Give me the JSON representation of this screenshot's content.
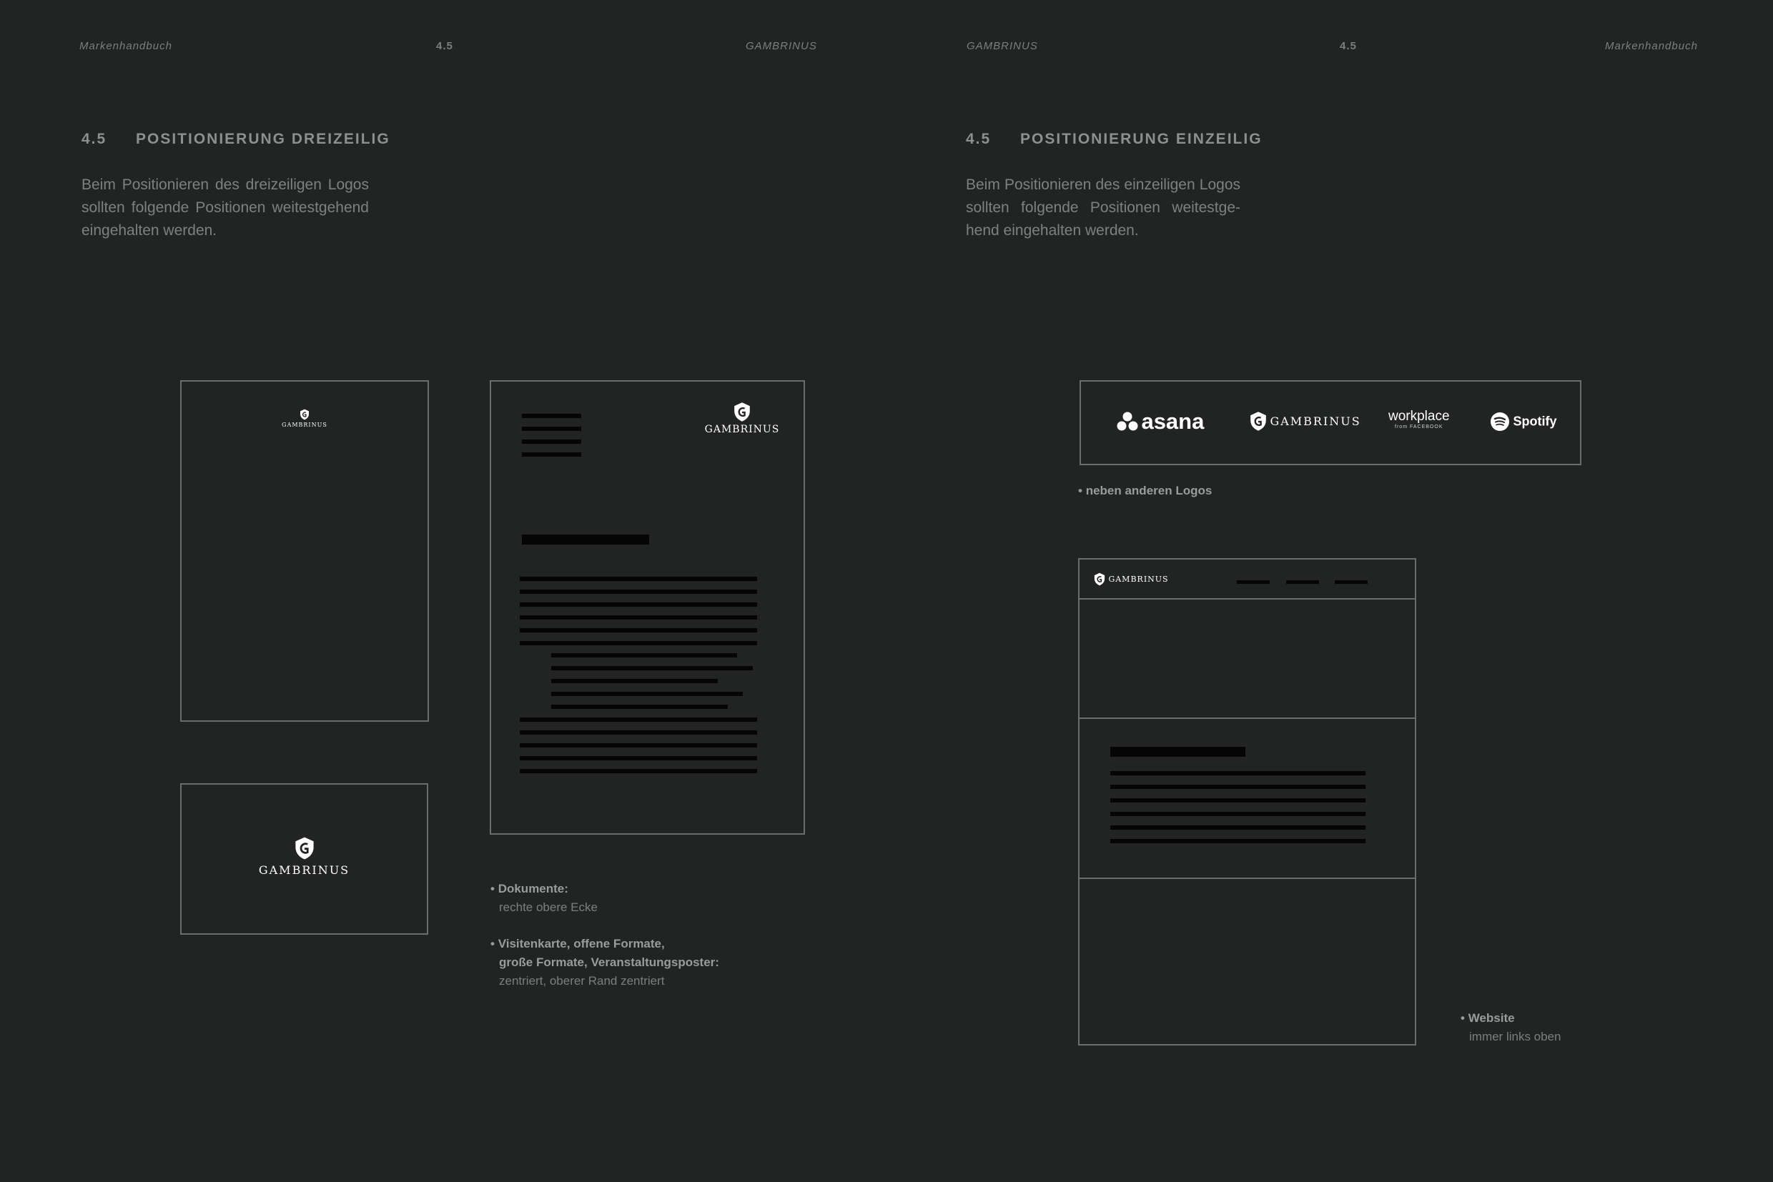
{
  "header": {
    "left_page": {
      "handbook": "Markenhandbuch",
      "section": "4.5",
      "brand": "GAMBRINUS"
    },
    "right_page": {
      "brand": "GAMBRINUS",
      "section": "4.5",
      "handbook": "Markenhandbuch"
    }
  },
  "left_section": {
    "number": "4.5",
    "title": "POSITIONIERUNG DREIZEILIG",
    "description": "Beim Positionieren des dreizeiligen Logos sollten folgende Positionen weitestgehend eingehalten werden."
  },
  "right_section": {
    "number": "4.5",
    "title": "POSITIONIERUNG EINZEILIG",
    "description": "Beim Positionieren des einzeiligen Logos sollten folgende Positionen weitestge-hend eingehalten werden."
  },
  "logo": {
    "wordmark": "GAMBRINUS",
    "icon": "shield-icon"
  },
  "captions": {
    "documents_title": "Dokumente:",
    "documents_text": "rechte obere Ecke",
    "formats_title_1": "Visitenkarte, offene Formate,",
    "formats_title_2": "große Formate, Veranstaltungsposter:",
    "formats_text": "zentriert, oberer Rand zentriert",
    "other_logos": "neben anderen Logos",
    "website_title": "Website",
    "website_text": "immer links oben"
  },
  "partner_logos": [
    "asana",
    "GAMBRINUS",
    "workplace",
    "Spotify"
  ],
  "partner_sub": {
    "workplace": "from FACEBOOK"
  },
  "colors": {
    "background": "#222424",
    "frame": "#6c6e6d",
    "placeholder_bar": "#050505",
    "logo": "#ffffff"
  }
}
